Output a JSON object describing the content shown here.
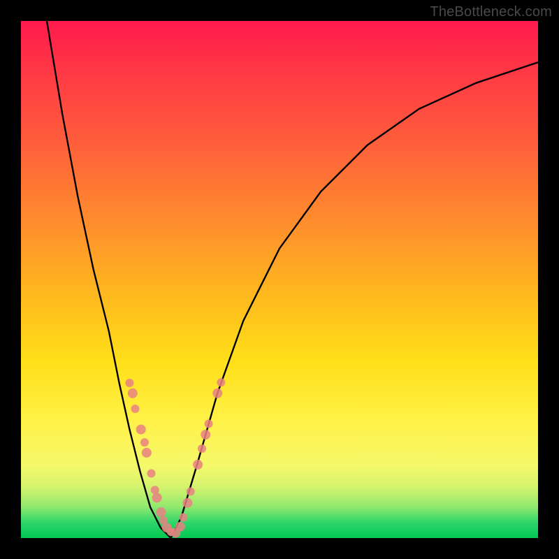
{
  "watermark": {
    "text": "TheBottleneck.com"
  },
  "chart_data": {
    "type": "line",
    "title": "",
    "xlabel": "",
    "ylabel": "",
    "xlim": [
      0,
      100
    ],
    "ylim": [
      0,
      100
    ],
    "grid": false,
    "curve_left": {
      "name": "left-branch",
      "points": [
        {
          "x": 5,
          "y": 100
        },
        {
          "x": 8,
          "y": 82
        },
        {
          "x": 11,
          "y": 66
        },
        {
          "x": 14,
          "y": 52
        },
        {
          "x": 17,
          "y": 40
        },
        {
          "x": 19,
          "y": 30
        },
        {
          "x": 21,
          "y": 21
        },
        {
          "x": 23,
          "y": 13
        },
        {
          "x": 25,
          "y": 6
        },
        {
          "x": 27,
          "y": 2
        },
        {
          "x": 29,
          "y": 0
        }
      ]
    },
    "curve_right": {
      "name": "right-branch",
      "points": [
        {
          "x": 29,
          "y": 0
        },
        {
          "x": 31,
          "y": 4
        },
        {
          "x": 34,
          "y": 14
        },
        {
          "x": 38,
          "y": 28
        },
        {
          "x": 43,
          "y": 42
        },
        {
          "x": 50,
          "y": 56
        },
        {
          "x": 58,
          "y": 67
        },
        {
          "x": 67,
          "y": 76
        },
        {
          "x": 77,
          "y": 83
        },
        {
          "x": 88,
          "y": 88
        },
        {
          "x": 100,
          "y": 92
        }
      ]
    },
    "markers_left": [
      {
        "x": 21.0,
        "y": 30.0,
        "r": 6
      },
      {
        "x": 21.6,
        "y": 28.0,
        "r": 7
      },
      {
        "x": 22.1,
        "y": 25.0,
        "r": 6
      },
      {
        "x": 23.2,
        "y": 21.0,
        "r": 7
      },
      {
        "x": 23.9,
        "y": 18.5,
        "r": 6
      },
      {
        "x": 24.3,
        "y": 16.5,
        "r": 7
      },
      {
        "x": 25.2,
        "y": 12.5,
        "r": 6
      },
      {
        "x": 25.9,
        "y": 9.3,
        "r": 6
      },
      {
        "x": 26.3,
        "y": 7.8,
        "r": 7
      },
      {
        "x": 27.1,
        "y": 5.0,
        "r": 7
      },
      {
        "x": 27.6,
        "y": 3.4,
        "r": 6
      },
      {
        "x": 28.2,
        "y": 2.0,
        "r": 7
      },
      {
        "x": 29.0,
        "y": 1.2,
        "r": 6
      },
      {
        "x": 29.9,
        "y": 1.0,
        "r": 7
      }
    ],
    "markers_right": [
      {
        "x": 30.8,
        "y": 2.2,
        "r": 7
      },
      {
        "x": 31.4,
        "y": 4.0,
        "r": 6
      },
      {
        "x": 32.2,
        "y": 6.8,
        "r": 7
      },
      {
        "x": 32.8,
        "y": 9.0,
        "r": 6
      },
      {
        "x": 34.2,
        "y": 14.2,
        "r": 7
      },
      {
        "x": 35.0,
        "y": 17.3,
        "r": 6
      },
      {
        "x": 35.7,
        "y": 20.0,
        "r": 7
      },
      {
        "x": 36.3,
        "y": 22.1,
        "r": 6
      },
      {
        "x": 38.0,
        "y": 28.0,
        "r": 7
      },
      {
        "x": 38.7,
        "y": 30.1,
        "r": 6
      }
    ]
  }
}
